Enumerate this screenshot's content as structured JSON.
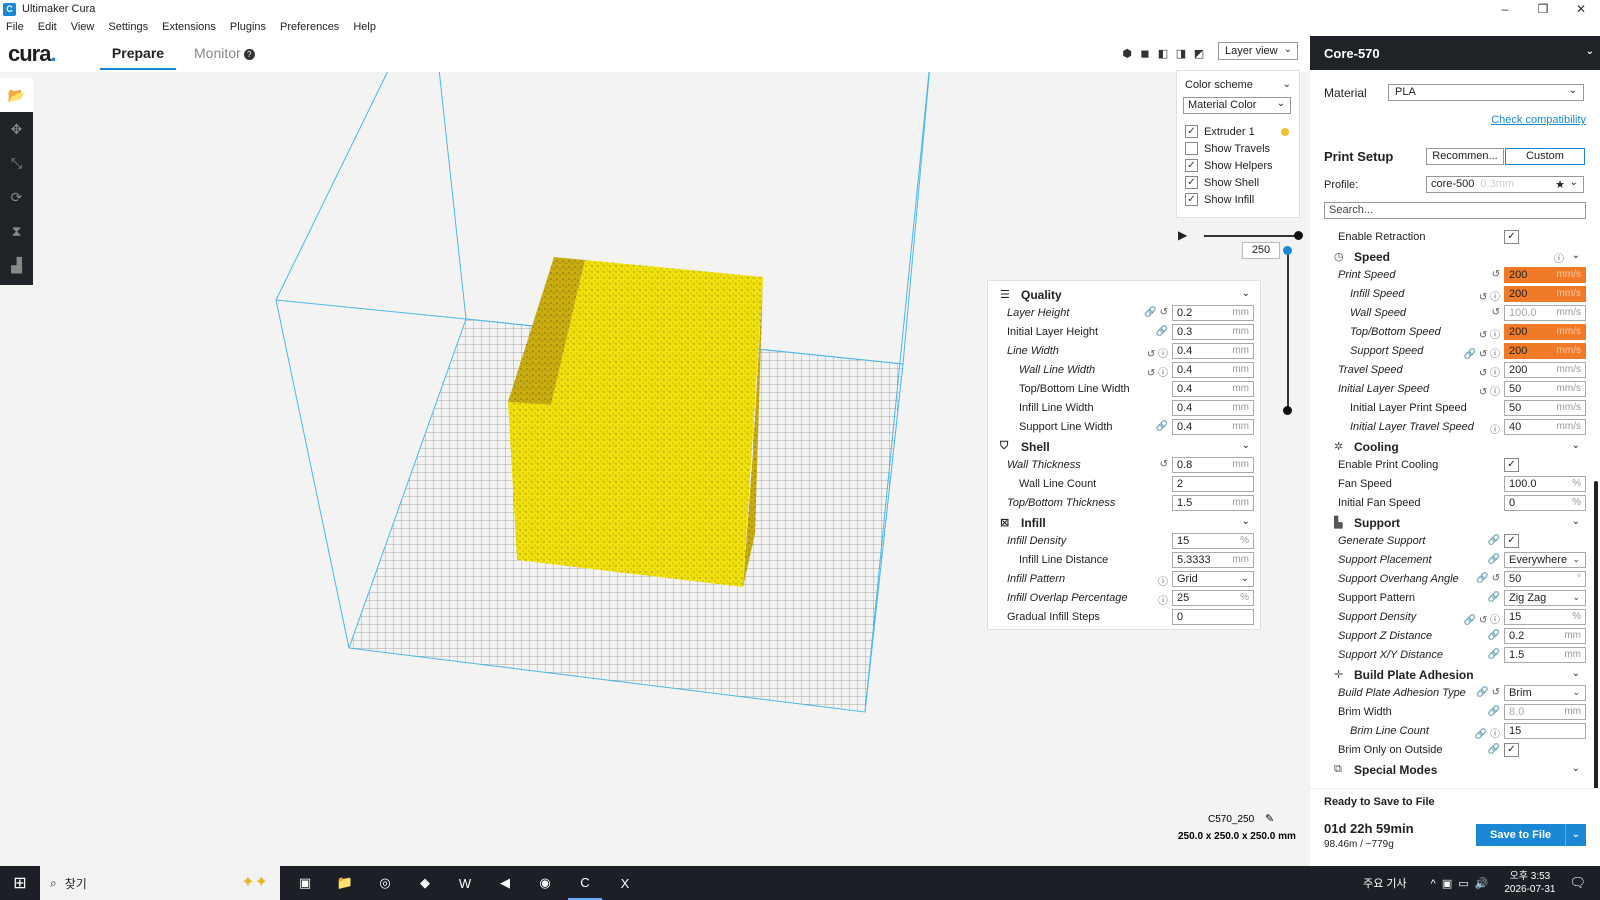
{
  "window": {
    "title": "Ultimaker Cura",
    "app_icon": "C",
    "minimize": "–",
    "restore": "❐",
    "close": "✕"
  },
  "menu": [
    "File",
    "Edit",
    "View",
    "Settings",
    "Extensions",
    "Plugins",
    "Preferences",
    "Help"
  ],
  "header": {
    "logo": "cura",
    "logo_dot": ".",
    "tabs": [
      {
        "label": "Prepare"
      },
      {
        "label": "Monitor"
      }
    ],
    "monitor_help": "?",
    "view_mode": "Layer view"
  },
  "color_panel": {
    "label": "Color scheme",
    "scheme": "Material Color",
    "options": [
      {
        "label": "Extruder 1",
        "checked": "✓"
      },
      {
        "label": "Show Travels",
        "checked": ""
      },
      {
        "label": "Show Helpers",
        "checked": "✓"
      },
      {
        "label": "Show Shell",
        "checked": "✓"
      },
      {
        "label": "Show Infill",
        "checked": "✓"
      }
    ],
    "extruder_color": "#f0c030"
  },
  "layer_slider": {
    "play": "▶",
    "current_layer": "250"
  },
  "quality_panel": {
    "categories": {
      "quality": "Quality",
      "shell": "Shell",
      "infill": "Infill"
    },
    "rows": [
      {
        "label": "Layer Height",
        "value": "0.2",
        "unit": "mm",
        "icons": "🔗 ↺"
      },
      {
        "label": "Initial Layer Height",
        "value": "0.3",
        "unit": "mm",
        "icons": "🔗"
      },
      {
        "label": "Line Width",
        "value": "0.4",
        "unit": "mm",
        "icons": "↺ ⓘ"
      },
      {
        "label": "Wall Line Width",
        "value": "0.4",
        "unit": "mm",
        "icons": "↺ ⓘ"
      },
      {
        "label": "Top/Bottom Line Width",
        "value": "0.4",
        "unit": "mm",
        "icons": ""
      },
      {
        "label": "Infill Line Width",
        "value": "0.4",
        "unit": "mm",
        "icons": ""
      },
      {
        "label": "Support Line Width",
        "value": "0.4",
        "unit": "mm",
        "icons": "🔗"
      },
      {
        "label": "Wall Thickness",
        "value": "0.8",
        "unit": "mm",
        "icons": "↺"
      },
      {
        "label": "Wall Line Count",
        "value": "2",
        "unit": "",
        "icons": ""
      },
      {
        "label": "Top/Bottom Thickness",
        "value": "1.5",
        "unit": "mm",
        "icons": ""
      },
      {
        "label": "Infill Density",
        "value": "15",
        "unit": "%",
        "icons": ""
      },
      {
        "label": "Infill Line Distance",
        "value": "5.3333",
        "unit": "mm",
        "icons": ""
      },
      {
        "label": "Infill Pattern",
        "value": "Grid",
        "unit": "",
        "icons": "ⓘ"
      },
      {
        "label": "Infill Overlap Percentage",
        "value": "25",
        "unit": "%",
        "icons": "ⓘ"
      },
      {
        "label": "Gradual Infill Steps",
        "value": "0",
        "unit": "",
        "icons": ""
      }
    ]
  },
  "right_panel": {
    "printer": "Core-570",
    "material_label": "Material",
    "material": "PLA",
    "check_compat": "Check compatibility",
    "print_setup": "Print Setup",
    "mode_recommended": "Recommen...",
    "mode_custom": "Custom",
    "profile_label": "Profile:",
    "profile": "core-500",
    "profile_layer": "0.3mm",
    "search_placeholder": "Search...",
    "categories": {
      "speed": "Speed",
      "cooling": "Cooling",
      "support": "Support",
      "adhesion": "Build Plate Adhesion",
      "special": "Special Modes"
    },
    "rows": [
      {
        "label": "Enable Retraction",
        "value": "✓",
        "unit": "",
        "icons": ""
      },
      {
        "label": "Print Speed",
        "value": "200",
        "unit": "mm/s",
        "icons": "↺"
      },
      {
        "label": "Infill Speed",
        "value": "200",
        "unit": "mm/s",
        "icons": "↺ ⓘ"
      },
      {
        "label": "Wall Speed",
        "value": "100.0",
        "unit": "mm/s",
        "icons": "↺"
      },
      {
        "label": "Top/Bottom Speed",
        "value": "200",
        "unit": "mm/s",
        "icons": "↺ ⓘ"
      },
      {
        "label": "Support Speed",
        "value": "200",
        "unit": "mm/s",
        "icons": "🔗 ↺ ⓘ"
      },
      {
        "label": "Travel Speed",
        "value": "200",
        "unit": "mm/s",
        "icons": "↺ ⓘ"
      },
      {
        "label": "Initial Layer Speed",
        "value": "50",
        "unit": "mm/s",
        "icons": "↺ ⓘ"
      },
      {
        "label": "Initial Layer Print Speed",
        "value": "50",
        "unit": "mm/s",
        "icons": ""
      },
      {
        "label": "Initial Layer Travel Speed",
        "value": "40",
        "unit": "mm/s",
        "icons": "ⓘ"
      },
      {
        "label": "Enable Print Cooling",
        "value": "✓",
        "unit": "",
        "icons": ""
      },
      {
        "label": "Fan Speed",
        "value": "100.0",
        "unit": "%",
        "icons": ""
      },
      {
        "label": "Initial Fan Speed",
        "value": "0",
        "unit": "%",
        "icons": ""
      },
      {
        "label": "Generate Support",
        "value": "✓",
        "unit": "",
        "icons": "🔗"
      },
      {
        "label": "Support Placement",
        "value": "Everywhere",
        "unit": "",
        "icons": "🔗"
      },
      {
        "label": "Support Overhang Angle",
        "value": "50",
        "unit": "°",
        "icons": "🔗 ↺"
      },
      {
        "label": "Support Pattern",
        "value": "Zig Zag",
        "unit": "",
        "icons": "🔗"
      },
      {
        "label": "Support Density",
        "value": "15",
        "unit": "%",
        "icons": "🔗 ↺ ⓘ"
      },
      {
        "label": "Support Z Distance",
        "value": "0.2",
        "unit": "mm",
        "icons": "🔗"
      },
      {
        "label": "Support X/Y Distance",
        "value": "1.5",
        "unit": "mm",
        "icons": "🔗"
      },
      {
        "label": "Build Plate Adhesion Type",
        "value": "Brim",
        "unit": "",
        "icons": "🔗 ↺"
      },
      {
        "label": "Brim Width",
        "value": "8.0",
        "unit": "mm",
        "icons": "🔗"
      },
      {
        "label": "Brim Line Count",
        "value": "15",
        "unit": "",
        "icons": "🔗 ⓘ"
      },
      {
        "label": "Brim Only on Outside",
        "value": "✓",
        "unit": "",
        "icons": "🔗"
      }
    ],
    "footer": {
      "ready": "Ready to Save to File",
      "time": "01d 22h 59min",
      "usage": "98.46m / ~779g",
      "save": "Save to File"
    }
  },
  "viewport": {
    "printer_name": "C570_250",
    "build_volume": "250.0 x 250.0 x 250.0 mm",
    "model_color": "#f2e20c",
    "volume_color": "#4ab8e8"
  },
  "taskbar": {
    "search": "찾기",
    "news": "주요 기사",
    "time": "오후 3:53",
    "date": "2026-07-31",
    "apps": [
      "▣",
      "📁",
      "◎",
      "◆",
      "W",
      "◀",
      "◉",
      "C",
      "X"
    ]
  }
}
